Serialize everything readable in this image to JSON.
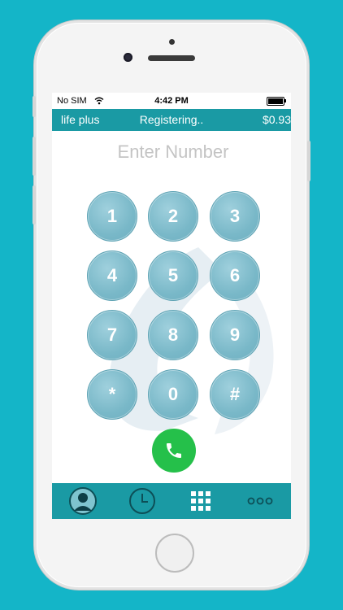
{
  "status_bar": {
    "carrier": "No SIM",
    "time": "4:42 PM"
  },
  "app_bar": {
    "brand": "life plus",
    "status": "Registering..",
    "balance": "$0.93"
  },
  "dialer": {
    "placeholder": "Enter Number",
    "keys": [
      "1",
      "2",
      "3",
      "4",
      "5",
      "6",
      "7",
      "8",
      "9",
      "*",
      "0",
      "#"
    ]
  },
  "icons": {
    "call": "phone-icon",
    "tabs": [
      "contacts-icon",
      "recents-clock-icon",
      "keypad-grid-icon",
      "more-dots-icon"
    ]
  },
  "colors": {
    "background": "#14b5c8",
    "bar": "#1a9aa4",
    "key": "#79b8c8",
    "call": "#25c04a"
  }
}
